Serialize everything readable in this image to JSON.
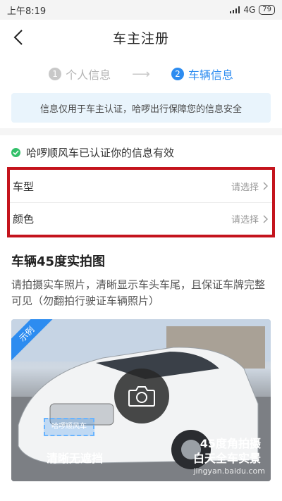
{
  "status": {
    "time": "上午8:19",
    "network": "4G",
    "battery": "79"
  },
  "nav": {
    "title": "车主注册"
  },
  "steps": [
    {
      "num": "1",
      "label": "个人信息"
    },
    {
      "num": "2",
      "label": "车辆信息"
    }
  ],
  "notice": "信息仅用于车主认证，哈啰出行保障您的信息安全",
  "verified_text": "哈啰顺风车已认证你的信息有效",
  "form": {
    "rows": [
      {
        "label": "车型",
        "placeholder": "请选择"
      },
      {
        "label": "颜色",
        "placeholder": "请选择"
      }
    ]
  },
  "photo_section": {
    "title": "车辆45度实拍图",
    "desc": "请拍摄实车照片，清晰显示车头车尾，且保证车牌完整可见（勿翻拍行驶证车辆照片）",
    "badge": "示例",
    "plate_text": "哈啰顺风车",
    "caption_left": "清晰无遮挡",
    "caption_right_line1": "45度角拍摄",
    "caption_right_line2": "白天全车实景",
    "watermark": "jingyan.baidu.com"
  },
  "colors": {
    "accent": "#2d8cf0",
    "highlight_border": "#c4141d",
    "success": "#33c06a",
    "notice_bg": "#e9f4fc"
  }
}
